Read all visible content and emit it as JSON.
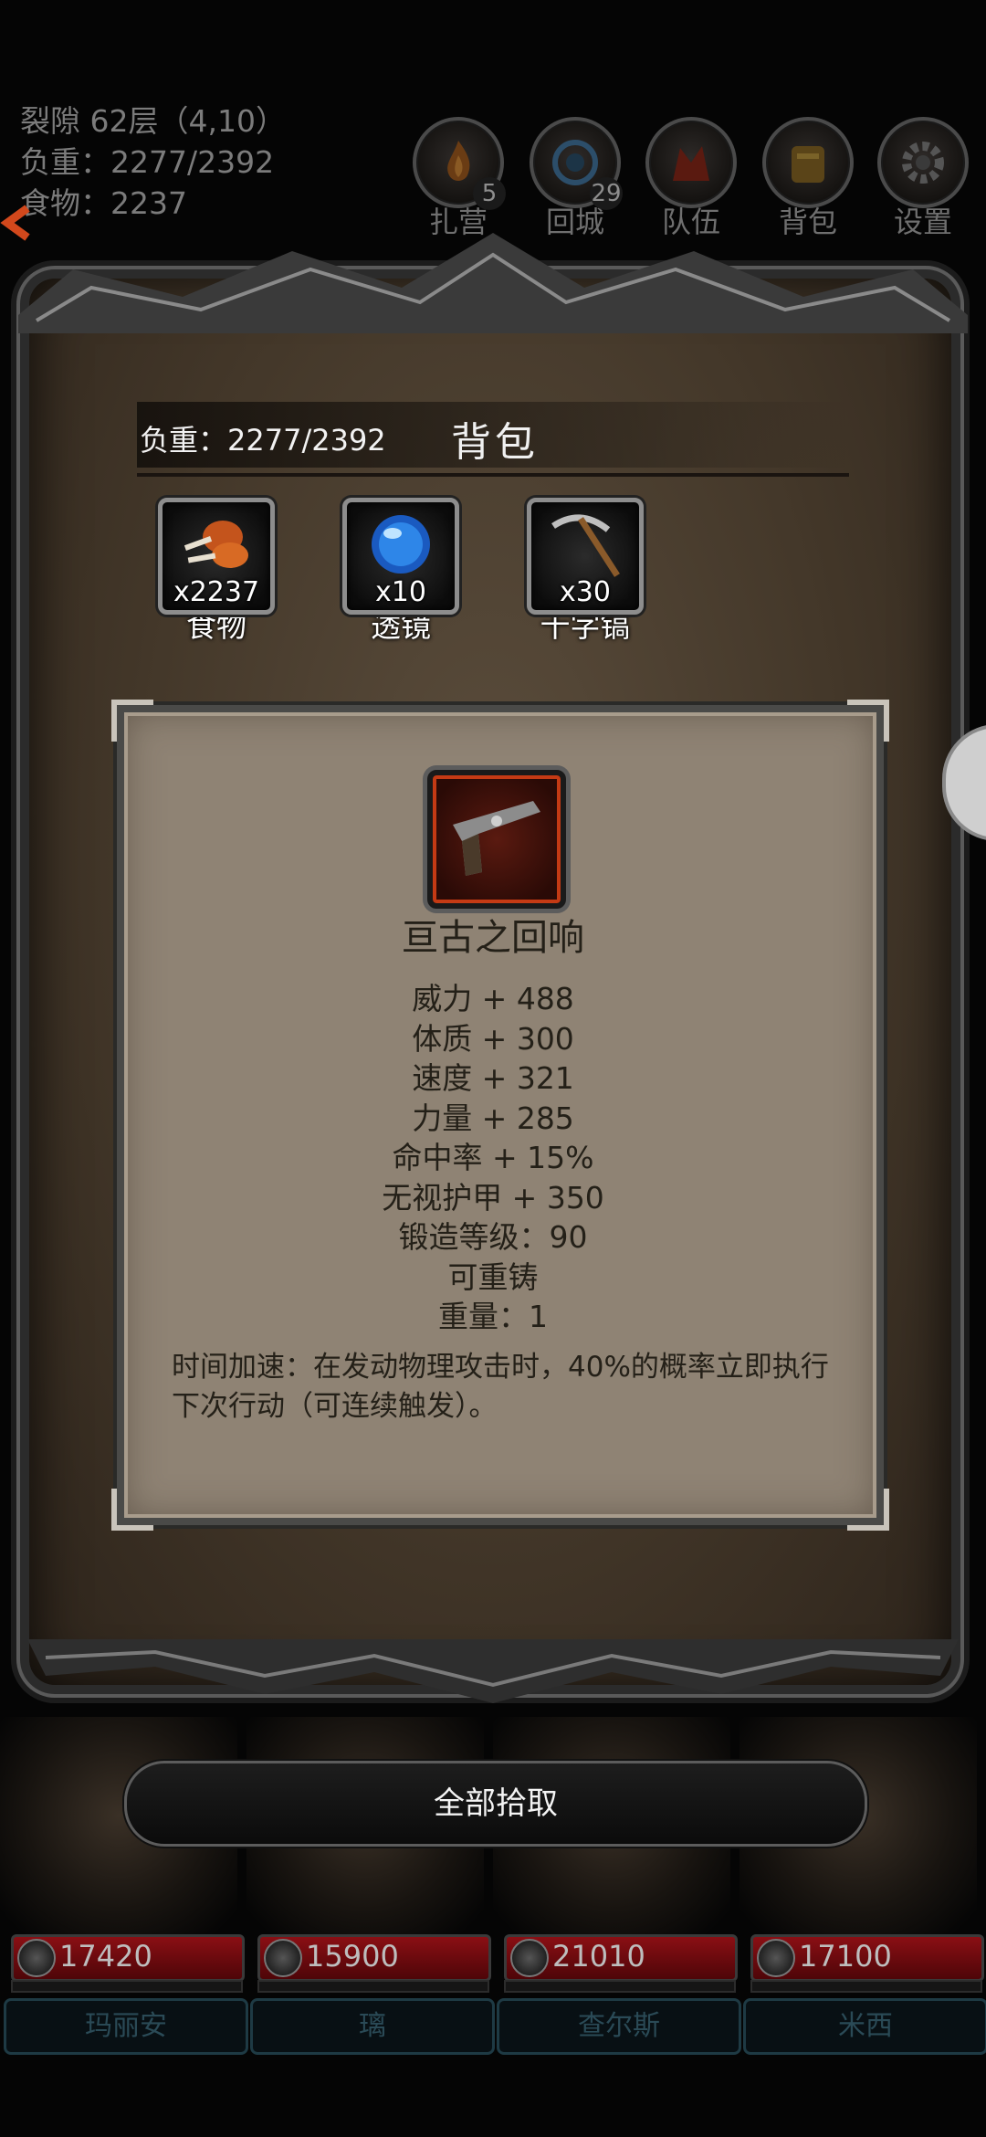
{
  "hud": {
    "location": "裂隙 62层（4,10）",
    "weight": "负重：2277/2392",
    "food": "食物：2237"
  },
  "top_buttons": [
    {
      "label": "扎营",
      "count": "5",
      "icon": "campfire-icon"
    },
    {
      "label": "回城",
      "count": "29",
      "icon": "portal-icon"
    },
    {
      "label": "队伍",
      "count": "",
      "icon": "team-icon"
    },
    {
      "label": "背包",
      "count": "",
      "icon": "backpack-icon"
    },
    {
      "label": "设置",
      "count": "",
      "icon": "gear-icon"
    }
  ],
  "bag": {
    "weight_label": "负重：2277/2392",
    "title": "背包",
    "slots": [
      {
        "qty": "x2237",
        "name": "食物",
        "icon": "meat-icon"
      },
      {
        "qty": "x10",
        "name": "透镜",
        "icon": "lens-icon"
      },
      {
        "qty": "x30",
        "name": "十字镐",
        "icon": "pickaxe-icon"
      }
    ]
  },
  "item": {
    "icon": "pistol-icon",
    "name": "亘古之回响",
    "stats": [
      "威力 + 488",
      "体质 + 300",
      "速度 + 321",
      "力量 + 285",
      "命中率 + 15%",
      "无视护甲 + 350",
      "锻造等级：90",
      "可重铸",
      "重量：1"
    ],
    "description": "时间加速：在发动物理攻击时，40%的概率立即执行下次行动（可连续触发）。"
  },
  "pickup_label": "全部拾取",
  "party": [
    {
      "hp": "17420",
      "name": "玛丽安"
    },
    {
      "hp": "15900",
      "name": "璃"
    },
    {
      "hp": "21010",
      "name": "查尔斯"
    },
    {
      "hp": "17100",
      "name": "米西"
    }
  ],
  "colors": {
    "card_bg": "#8f8374",
    "panel_bg": "#433729",
    "hp_bar": "#8a0f14",
    "item_frame": "#c43a14"
  }
}
